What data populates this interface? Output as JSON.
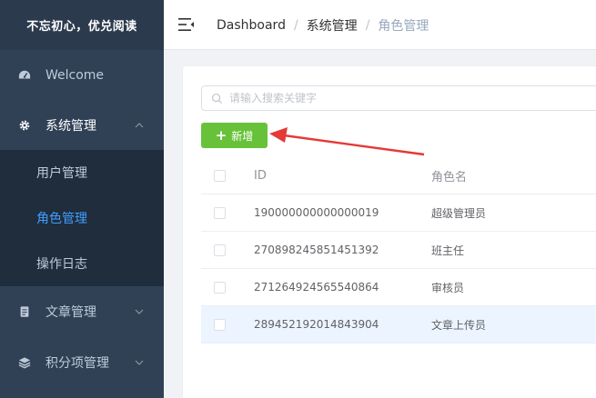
{
  "sidebar": {
    "brand": "不忘初心，优兑阅读",
    "items": [
      {
        "label": "Welcome",
        "icon": "dashboard-icon"
      },
      {
        "label": "系统管理",
        "icon": "gear-icon",
        "expanded": true
      },
      {
        "label": "文章管理",
        "icon": "document-icon"
      },
      {
        "label": "积分项管理",
        "icon": "layers-icon"
      }
    ],
    "submenu": [
      {
        "label": "用户管理"
      },
      {
        "label": "角色管理",
        "active": true
      },
      {
        "label": "操作日志"
      }
    ]
  },
  "header": {
    "breadcrumb": [
      "Dashboard",
      "系统管理",
      "角色管理"
    ]
  },
  "search": {
    "placeholder": "请输入搜索关键字"
  },
  "toolbar": {
    "add_label": "新增"
  },
  "table": {
    "columns": [
      "ID",
      "角色名"
    ],
    "rows": [
      {
        "id": "190000000000000019",
        "name": "超级管理员"
      },
      {
        "id": "270898245851451392",
        "name": "班主任"
      },
      {
        "id": "271264924565540864",
        "name": "审核员"
      },
      {
        "id": "289452192014843904",
        "name": "文章上传员"
      }
    ]
  },
  "colors": {
    "sidebar_bg": "#304156",
    "submenu_bg": "#1f2d3d",
    "active_text": "#409eff",
    "add_button": "#67c23a",
    "annotation_arrow": "#e53935"
  }
}
